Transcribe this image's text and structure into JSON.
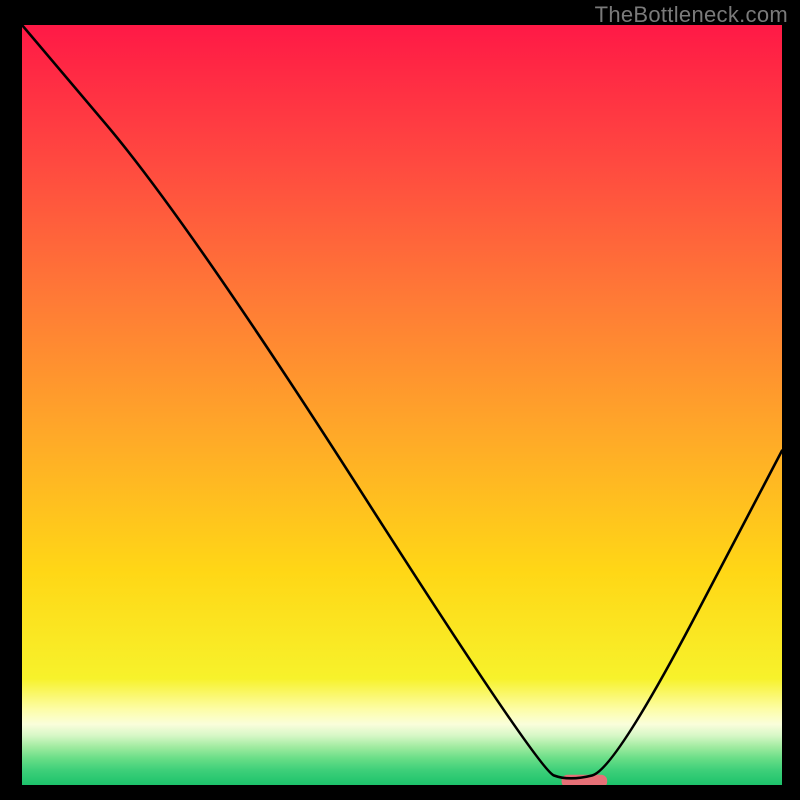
{
  "watermark": "TheBottleneck.com",
  "chart_data": {
    "type": "line",
    "title": "",
    "xlabel": "",
    "ylabel": "",
    "xlim": [
      0,
      100
    ],
    "ylim": [
      0,
      100
    ],
    "grid": false,
    "series": [
      {
        "name": "curve",
        "x": [
          0,
          22,
          68,
          72,
          78,
          100
        ],
        "values": [
          100,
          74,
          2,
          0.5,
          2,
          44
        ]
      }
    ],
    "marker": {
      "x_start": 71,
      "x_end": 77,
      "y": 0.5,
      "color": "#e67077"
    },
    "background_gradient": {
      "orientation": "vertical",
      "stops": [
        {
          "pos": 0.0,
          "color": "#ff1946"
        },
        {
          "pos": 0.18,
          "color": "#ff4940"
        },
        {
          "pos": 0.36,
          "color": "#ff7a36"
        },
        {
          "pos": 0.54,
          "color": "#ffa928"
        },
        {
          "pos": 0.72,
          "color": "#ffd716"
        },
        {
          "pos": 0.86,
          "color": "#f7f22b"
        },
        {
          "pos": 0.9,
          "color": "#fdfda6"
        },
        {
          "pos": 0.92,
          "color": "#fafedb"
        },
        {
          "pos": 0.935,
          "color": "#d6f7c6"
        },
        {
          "pos": 0.95,
          "color": "#a0eba0"
        },
        {
          "pos": 0.965,
          "color": "#69de87"
        },
        {
          "pos": 0.98,
          "color": "#3fd07a"
        },
        {
          "pos": 1.0,
          "color": "#1cc26b"
        }
      ]
    }
  }
}
